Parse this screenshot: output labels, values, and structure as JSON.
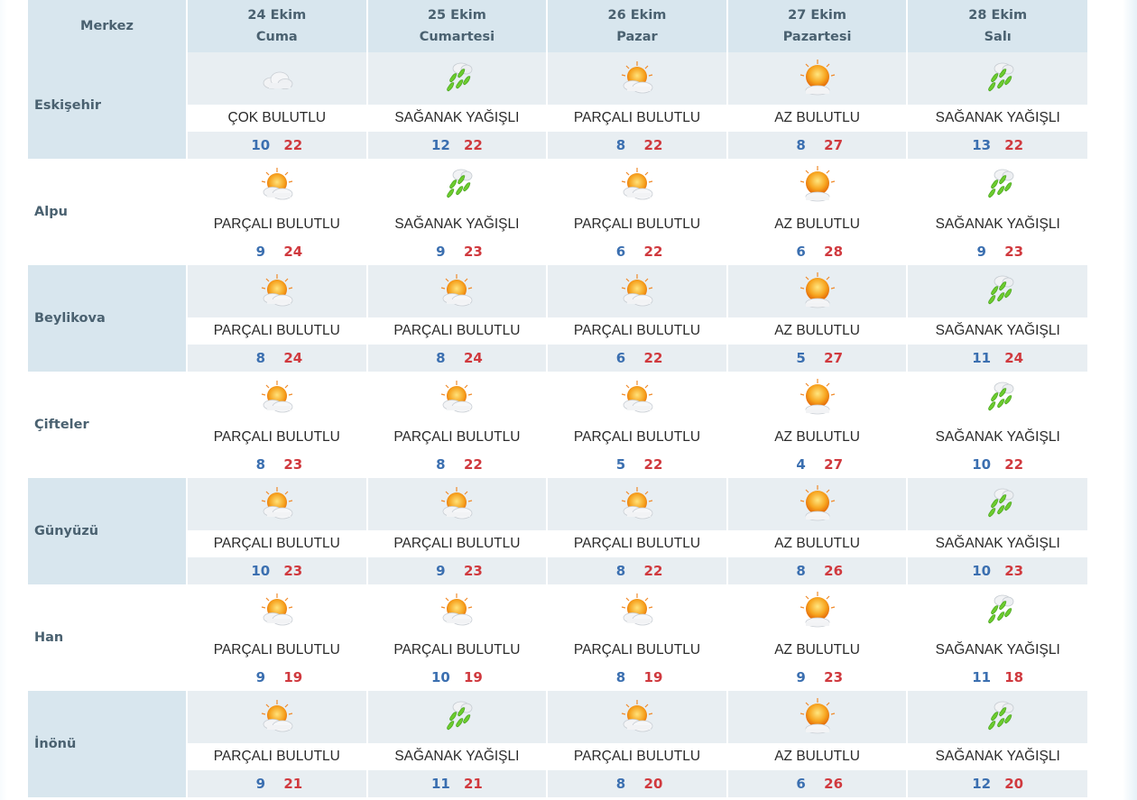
{
  "header": {
    "center_label": "Merkez",
    "days": [
      {
        "date": "24 Ekim",
        "name": "Cuma"
      },
      {
        "date": "25 Ekim",
        "name": "Cumartesi"
      },
      {
        "date": "26 Ekim",
        "name": "Pazar"
      },
      {
        "date": "27 Ekim",
        "name": "Pazartesi"
      },
      {
        "date": "28 Ekim",
        "name": "Salı"
      }
    ]
  },
  "cities": [
    {
      "name": "Eskişehir",
      "days": [
        {
          "icon": "cloudy-icon",
          "cond": "ÇOK BULUTLU",
          "min": "10",
          "max": "22"
        },
        {
          "icon": "rain-shower-icon",
          "cond": "SAĞANAK YAĞIŞLI",
          "min": "12",
          "max": "22"
        },
        {
          "icon": "partly-cloudy-icon",
          "cond": "PARÇALI BULUTLU",
          "min": "8",
          "max": "22"
        },
        {
          "icon": "mostly-sunny-icon",
          "cond": "AZ BULUTLU",
          "min": "8",
          "max": "27"
        },
        {
          "icon": "rain-shower-icon",
          "cond": "SAĞANAK YAĞIŞLI",
          "min": "13",
          "max": "22"
        }
      ]
    },
    {
      "name": "Alpu",
      "days": [
        {
          "icon": "partly-cloudy-icon",
          "cond": "PARÇALI BULUTLU",
          "min": "9",
          "max": "24"
        },
        {
          "icon": "rain-shower-icon",
          "cond": "SAĞANAK YAĞIŞLI",
          "min": "9",
          "max": "23"
        },
        {
          "icon": "partly-cloudy-icon",
          "cond": "PARÇALI BULUTLU",
          "min": "6",
          "max": "22"
        },
        {
          "icon": "mostly-sunny-icon",
          "cond": "AZ BULUTLU",
          "min": "6",
          "max": "28"
        },
        {
          "icon": "rain-shower-icon",
          "cond": "SAĞANAK YAĞIŞLI",
          "min": "9",
          "max": "23"
        }
      ]
    },
    {
      "name": "Beylikova",
      "days": [
        {
          "icon": "partly-cloudy-icon",
          "cond": "PARÇALI BULUTLU",
          "min": "8",
          "max": "24"
        },
        {
          "icon": "partly-cloudy-icon",
          "cond": "PARÇALI BULUTLU",
          "min": "8",
          "max": "24"
        },
        {
          "icon": "partly-cloudy-icon",
          "cond": "PARÇALI BULUTLU",
          "min": "6",
          "max": "22"
        },
        {
          "icon": "mostly-sunny-icon",
          "cond": "AZ BULUTLU",
          "min": "5",
          "max": "27"
        },
        {
          "icon": "rain-shower-icon",
          "cond": "SAĞANAK YAĞIŞLI",
          "min": "11",
          "max": "24"
        }
      ]
    },
    {
      "name": "Çifteler",
      "days": [
        {
          "icon": "partly-cloudy-icon",
          "cond": "PARÇALI BULUTLU",
          "min": "8",
          "max": "23"
        },
        {
          "icon": "partly-cloudy-icon",
          "cond": "PARÇALI BULUTLU",
          "min": "8",
          "max": "22"
        },
        {
          "icon": "partly-cloudy-icon",
          "cond": "PARÇALI BULUTLU",
          "min": "5",
          "max": "22"
        },
        {
          "icon": "mostly-sunny-icon",
          "cond": "AZ BULUTLU",
          "min": "4",
          "max": "27"
        },
        {
          "icon": "rain-shower-icon",
          "cond": "SAĞANAK YAĞIŞLI",
          "min": "10",
          "max": "22"
        }
      ]
    },
    {
      "name": "Günyüzü",
      "days": [
        {
          "icon": "partly-cloudy-icon",
          "cond": "PARÇALI BULUTLU",
          "min": "10",
          "max": "23"
        },
        {
          "icon": "partly-cloudy-icon",
          "cond": "PARÇALI BULUTLU",
          "min": "9",
          "max": "23"
        },
        {
          "icon": "partly-cloudy-icon",
          "cond": "PARÇALI BULUTLU",
          "min": "8",
          "max": "22"
        },
        {
          "icon": "mostly-sunny-icon",
          "cond": "AZ BULUTLU",
          "min": "8",
          "max": "26"
        },
        {
          "icon": "rain-shower-icon",
          "cond": "SAĞANAK YAĞIŞLI",
          "min": "10",
          "max": "23"
        }
      ]
    },
    {
      "name": "Han",
      "days": [
        {
          "icon": "partly-cloudy-icon",
          "cond": "PARÇALI BULUTLU",
          "min": "9",
          "max": "19"
        },
        {
          "icon": "partly-cloudy-icon",
          "cond": "PARÇALI BULUTLU",
          "min": "10",
          "max": "19"
        },
        {
          "icon": "partly-cloudy-icon",
          "cond": "PARÇALI BULUTLU",
          "min": "8",
          "max": "19"
        },
        {
          "icon": "mostly-sunny-icon",
          "cond": "AZ BULUTLU",
          "min": "9",
          "max": "23"
        },
        {
          "icon": "rain-shower-icon",
          "cond": "SAĞANAK YAĞIŞLI",
          "min": "11",
          "max": "18"
        }
      ]
    },
    {
      "name": "İnönü",
      "days": [
        {
          "icon": "partly-cloudy-icon",
          "cond": "PARÇALI BULUTLU",
          "min": "9",
          "max": "21"
        },
        {
          "icon": "rain-shower-icon",
          "cond": "SAĞANAK YAĞIŞLI",
          "min": "11",
          "max": "21"
        },
        {
          "icon": "partly-cloudy-icon",
          "cond": "PARÇALI BULUTLU",
          "min": "8",
          "max": "20"
        },
        {
          "icon": "mostly-sunny-icon",
          "cond": "AZ BULUTLU",
          "min": "6",
          "max": "26"
        },
        {
          "icon": "rain-shower-icon",
          "cond": "SAĞANAK YAĞIŞLI",
          "min": "12",
          "max": "20"
        }
      ]
    }
  ],
  "colors": {
    "header_bg": "#d8e6ee",
    "min_temp": "#3b6fb0",
    "max_temp": "#d0393e",
    "label_text": "#4a6170"
  }
}
